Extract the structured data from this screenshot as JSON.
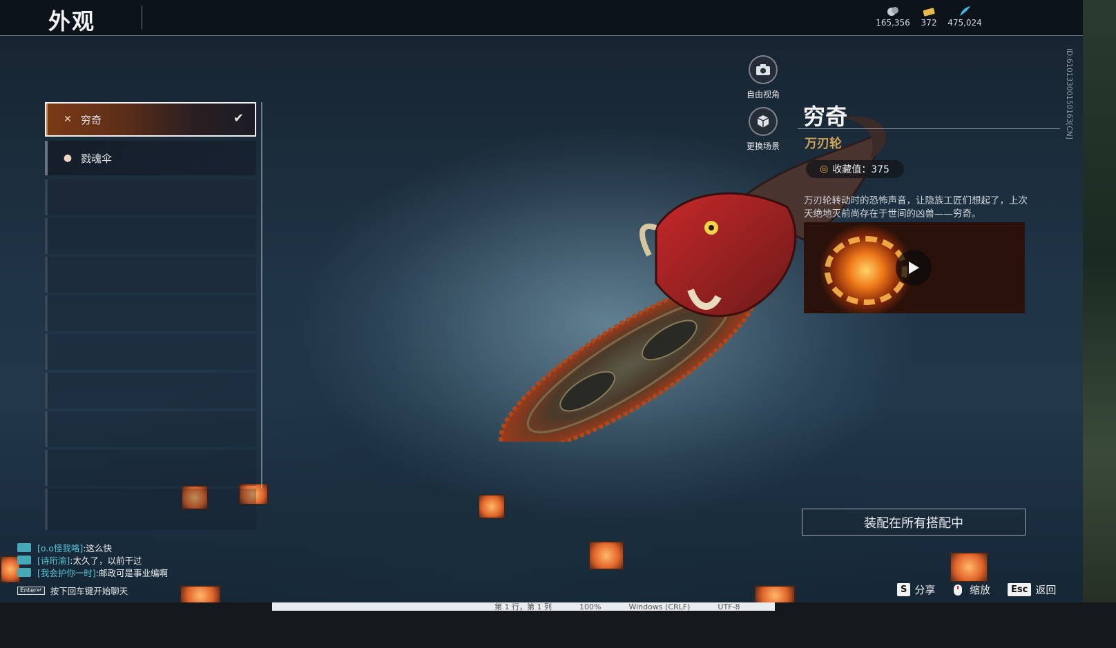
{
  "header": {
    "title": "外观",
    "currencies": [
      {
        "icon": "silver-coins-icon",
        "value": "165,356",
        "color": "#c9d0d8"
      },
      {
        "icon": "gold-ticket-icon",
        "value": "372",
        "color": "#e9b84a"
      },
      {
        "icon": "blue-feather-icon",
        "value": "475,024",
        "color": "#3fb6e6"
      }
    ]
  },
  "list": {
    "items": [
      {
        "label": "穷奇",
        "icon": "crossed-blades-icon",
        "selected": true
      },
      {
        "label": "戮魂伞",
        "icon": "droplet-icon",
        "selected": false
      }
    ],
    "empty_slots": 9
  },
  "tools": {
    "free_view": "自由视角",
    "change_scene": "更换场景"
  },
  "item": {
    "name": "穷奇",
    "type": "万刃轮",
    "collection_label": "收藏值：375",
    "description": "万刃轮转动时的恐怖声音，让隐族工匠们想起了，上次天绝地灭前尚存在于世间的凶兽——穷奇。",
    "equip_button": "装配在所有搭配中"
  },
  "server_id": "ID:6101330015016З[CN]",
  "keys": [
    {
      "cap": "S",
      "label": "分享"
    },
    {
      "cap": "",
      "label": "缩放"
    },
    {
      "cap": "Esc",
      "label": "返回"
    }
  ],
  "chat": {
    "lines": [
      {
        "name": "[o.o怪我咯]",
        "message": ":这么快"
      },
      {
        "name": "[诗珩渝]",
        "message": ":太久了，以前干过"
      },
      {
        "name": "[我会护你一时]",
        "message": ":邮政可是事业编啊"
      }
    ],
    "enter_key": "Enter↵",
    "hint": "按下回车键开始聊天"
  },
  "editor_status": {
    "position": "第 1 行，第 1 列",
    "zoom": "100%",
    "line_ending": "Windows (CRLF)",
    "encoding": "UTF-8"
  }
}
